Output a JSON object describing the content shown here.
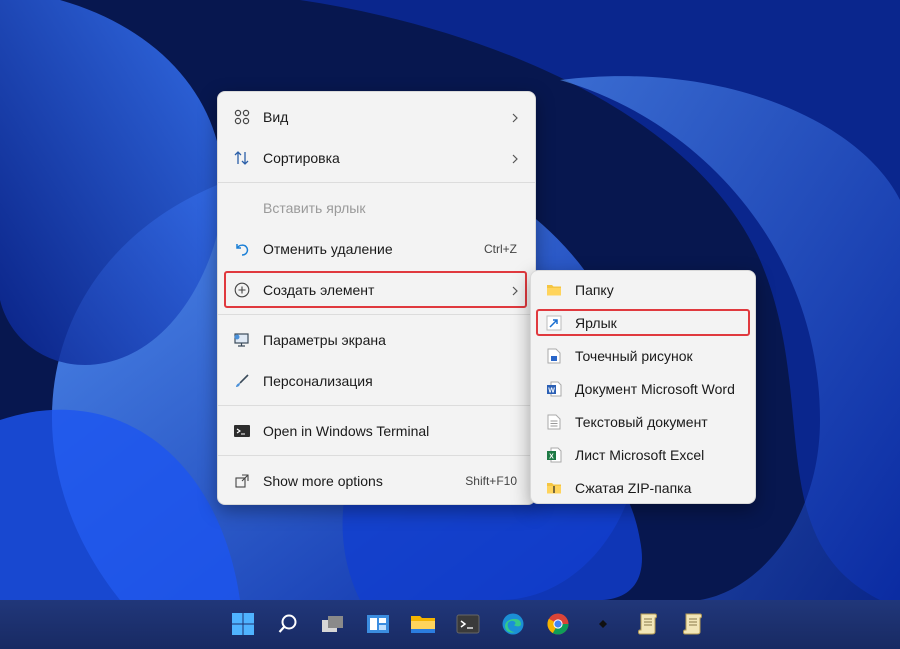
{
  "context_menu": {
    "items": [
      {
        "label": "Вид",
        "icon": "grid-icon",
        "submenu": true
      },
      {
        "label": "Сортировка",
        "icon": "sort-icon",
        "submenu": true
      },
      {
        "label": "Вставить ярлык",
        "icon": "",
        "disabled": true
      },
      {
        "label": "Отменить удаление",
        "icon": "undo-icon",
        "shortcut": "Ctrl+Z"
      },
      {
        "label": "Создать элемент",
        "icon": "add-circle-icon",
        "submenu": true
      },
      {
        "label": "Параметры экрана",
        "icon": "display-icon"
      },
      {
        "label": "Персонализация",
        "icon": "brush-icon"
      },
      {
        "label": "Open in Windows Terminal",
        "icon": "terminal-icon"
      },
      {
        "label": "Show more options",
        "icon": "expand-icon",
        "shortcut": "Shift+F10"
      }
    ]
  },
  "submenu": {
    "items": [
      {
        "label": "Папку",
        "icon": "folder-icon"
      },
      {
        "label": "Ярлык",
        "icon": "shortcut-icon"
      },
      {
        "label": "Точечный рисунок",
        "icon": "bitmap-icon"
      },
      {
        "label": "Документ Microsoft Word",
        "icon": "word-icon"
      },
      {
        "label": "Текстовый документ",
        "icon": "text-document-icon"
      },
      {
        "label": "Лист Microsoft Excel",
        "icon": "excel-icon"
      },
      {
        "label": "Сжатая ZIP-папка",
        "icon": "zip-folder-icon"
      }
    ]
  },
  "taskbar": {
    "icons": [
      "start-icon",
      "search-icon",
      "task-view-icon",
      "widgets-icon",
      "file-explorer-icon",
      "terminal-icon",
      "edge-icon",
      "chrome-icon",
      "app-icon",
      "document-icon",
      "document-icon"
    ]
  },
  "colors": {
    "highlight": "#e0393e",
    "accent": "#0067c0"
  }
}
